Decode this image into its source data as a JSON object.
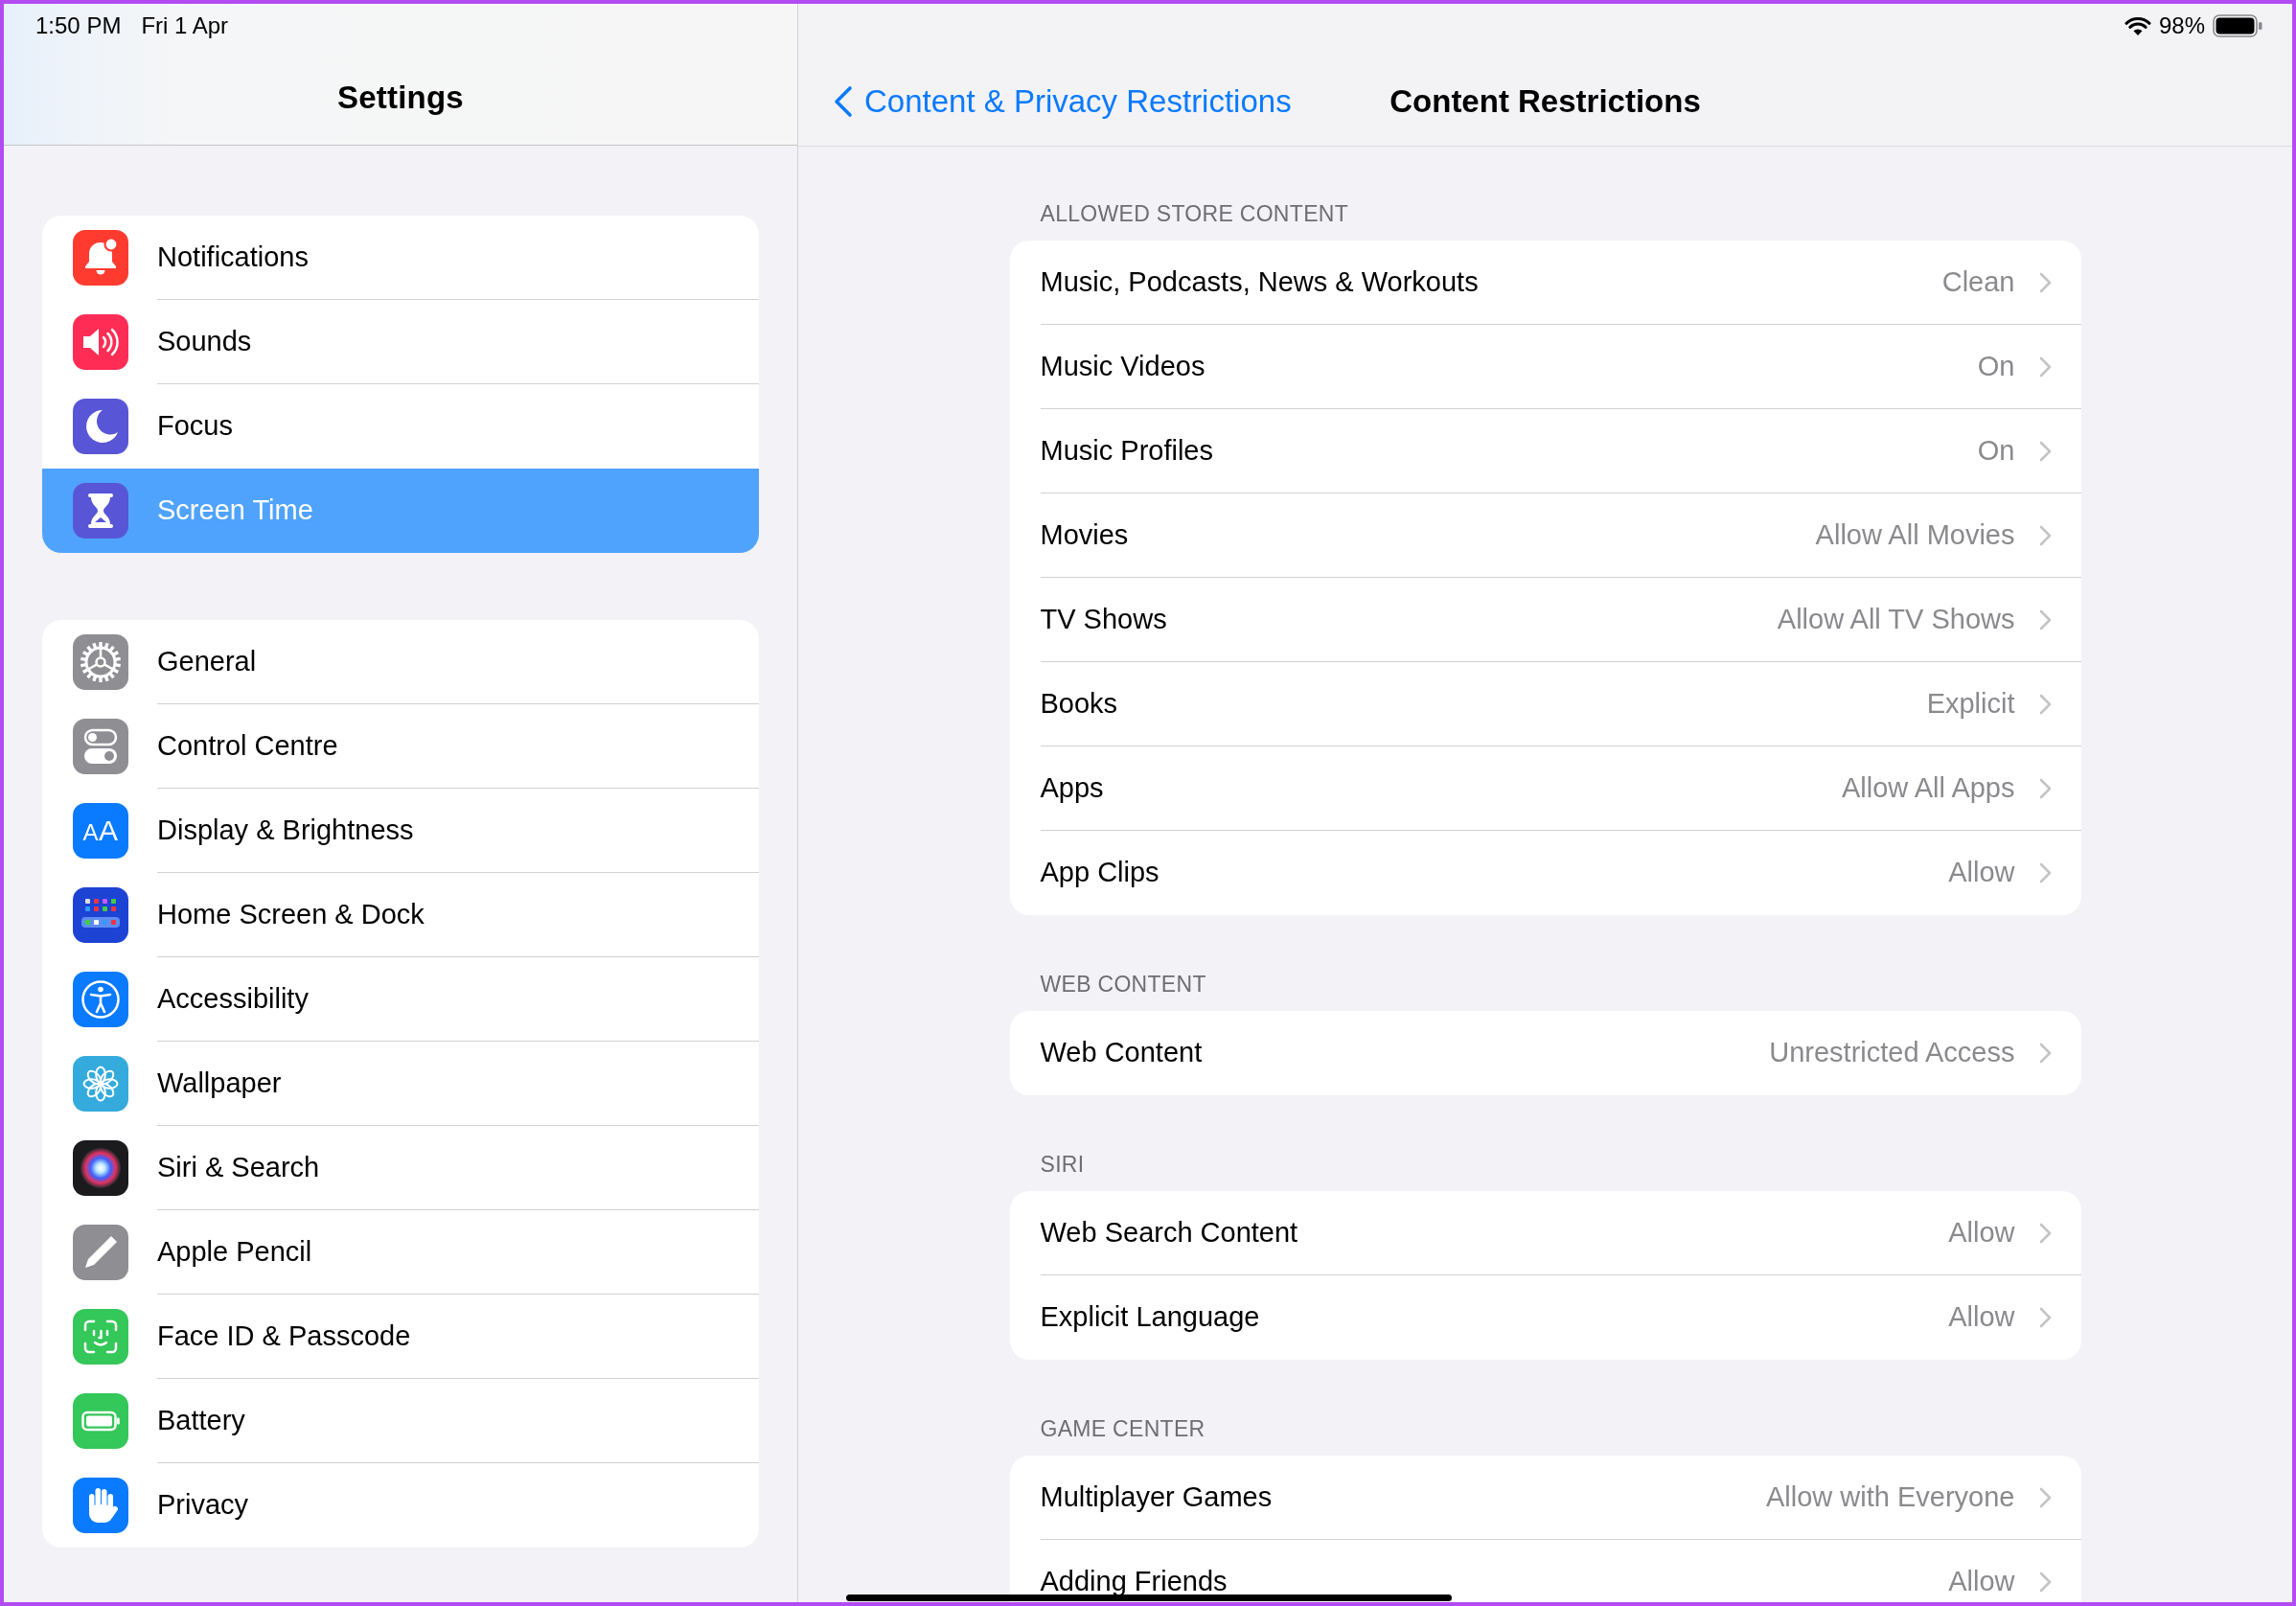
{
  "status_bar": {
    "time": "1:50 PM",
    "date": "Fri 1 Apr",
    "battery": "98%"
  },
  "sidebar": {
    "title": "Settings",
    "groups": [
      {
        "items": [
          {
            "label": "Notifications",
            "selected": false
          },
          {
            "label": "Sounds",
            "selected": false
          },
          {
            "label": "Focus",
            "selected": false
          },
          {
            "label": "Screen Time",
            "selected": true
          }
        ]
      },
      {
        "items": [
          {
            "label": "General",
            "selected": false
          },
          {
            "label": "Control Centre",
            "selected": false
          },
          {
            "label": "Display & Brightness",
            "selected": false,
            "icon_text": "AA"
          },
          {
            "label": "Home Screen & Dock",
            "selected": false
          },
          {
            "label": "Accessibility",
            "selected": false
          },
          {
            "label": "Wallpaper",
            "selected": false
          },
          {
            "label": "Siri & Search",
            "selected": false
          },
          {
            "label": "Apple Pencil",
            "selected": false
          },
          {
            "label": "Face ID & Passcode",
            "selected": false
          },
          {
            "label": "Battery",
            "selected": false
          },
          {
            "label": "Privacy",
            "selected": false
          }
        ]
      }
    ]
  },
  "detail": {
    "back_button": "Content & Privacy Restrictions",
    "title": "Content Restrictions",
    "sections": [
      {
        "header": "ALLOWED STORE CONTENT",
        "rows": [
          {
            "label": "Music, Podcasts, News & Workouts",
            "value": "Clean"
          },
          {
            "label": "Music Videos",
            "value": "On"
          },
          {
            "label": "Music Profiles",
            "value": "On"
          },
          {
            "label": "Movies",
            "value": "Allow All Movies"
          },
          {
            "label": "TV Shows",
            "value": "Allow All TV Shows"
          },
          {
            "label": "Books",
            "value": "Explicit"
          },
          {
            "label": "Apps",
            "value": "Allow All Apps"
          },
          {
            "label": "App Clips",
            "value": "Allow"
          }
        ]
      },
      {
        "header": "WEB CONTENT",
        "rows": [
          {
            "label": "Web Content",
            "value": "Unrestricted Access"
          }
        ]
      },
      {
        "header": "SIRI",
        "rows": [
          {
            "label": "Web Search Content",
            "value": "Allow"
          },
          {
            "label": "Explicit Language",
            "value": "Allow"
          }
        ]
      },
      {
        "header": "GAME CENTER",
        "rows": [
          {
            "label": "Multiplayer Games",
            "value": "Allow with Everyone"
          },
          {
            "label": "Adding Friends",
            "value": "Allow"
          }
        ]
      }
    ]
  }
}
